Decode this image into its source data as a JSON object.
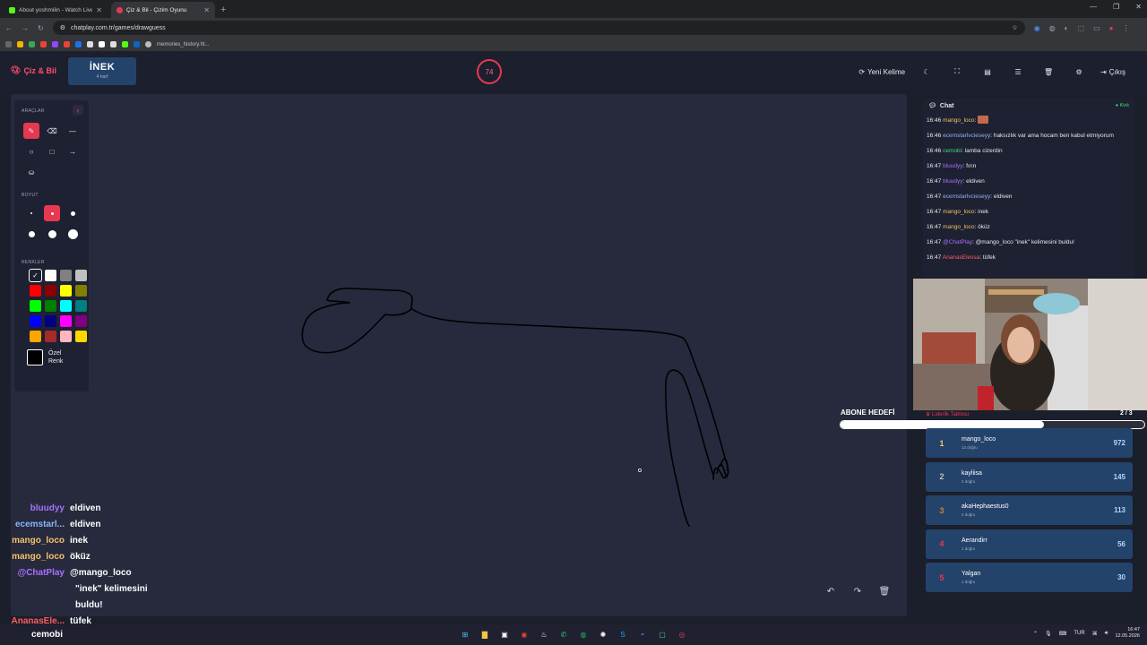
{
  "browser": {
    "tabs": [
      {
        "title": "About yoshmilin - Watch Live o...",
        "color": "#53fc18"
      },
      {
        "title": "Çiz & Bil - Çizim Oyunu",
        "color": "#e63950"
      }
    ],
    "url": "chatplay.com.tr/games/drawguess",
    "bookmark": "memories_history.ht..."
  },
  "header": {
    "logo": "Çiz & Bil",
    "word": "İNEK",
    "word_hint": "4 harf",
    "timer": "74",
    "new_word_label": "Yeni Kelime",
    "exit_label": "Çıkış"
  },
  "tools": {
    "section_tools": "ARAÇLAR",
    "section_size": "BOYUT",
    "section_colors": "RENKLER",
    "custom_color_label": "Özel Renk",
    "selected_tool": "brush",
    "colors": [
      "#000000",
      "#ffffff",
      "#808080",
      "#c0c0c0",
      "#ff0000",
      "#8b0000",
      "#ffff00",
      "#808000",
      "#00ff00",
      "#008000",
      "#00ffff",
      "#008080",
      "#0000ff",
      "#000080",
      "#ff00ff",
      "#800080",
      "#ffa500",
      "#a52a2a",
      "#ffb6c1",
      "#ffd700"
    ],
    "accent": "#e63950"
  },
  "overlay_chat": [
    {
      "user": "bluudyy",
      "msg": "eldiven",
      "color": "#a970ff"
    },
    {
      "user": "ecemstarl...",
      "msg": "eldiven",
      "color": "#8ab4f8"
    },
    {
      "user": "mango_loco",
      "msg": "inek",
      "color": "#f5c16c"
    },
    {
      "user": "mango_loco",
      "msg": "öküz",
      "color": "#f5c16c"
    },
    {
      "user": "@ChatPlay",
      "msg": "@mango_loco",
      "color": "#a970ff"
    }
  ],
  "overlay_wrap_1": "\"inek\" kelimesini",
  "overlay_wrap_2": "buldu!",
  "overlay_last": {
    "user": "AnanasEle...",
    "msg": "tüfek",
    "color": "#ff5c5c"
  },
  "chat": {
    "title": "Chat",
    "platform": "Kick",
    "messages": [
      {
        "time": "16:46",
        "user": "mango_loco",
        "msg": "",
        "color": "#f5c16c"
      },
      {
        "time": "16:46",
        "user": "ecemstarlvcieseyy",
        "msg": "haksızlık var ama hocam ben kabul etmiyorum",
        "color": "#8ab4f8"
      },
      {
        "time": "16:46",
        "user": "cemobi",
        "msg": "lamba cizerdin",
        "color": "#3ddc84"
      },
      {
        "time": "16:47",
        "user": "bluudyy",
        "msg": "fırın",
        "color": "#a970ff"
      },
      {
        "time": "16:47",
        "user": "bluudyy",
        "msg": "eldiven",
        "color": "#a970ff"
      },
      {
        "time": "16:47",
        "user": "ecemstarlvcieseyy",
        "msg": "eldiven",
        "color": "#8ab4f8"
      },
      {
        "time": "16:47",
        "user": "mango_loco",
        "msg": "inek",
        "color": "#f5c16c"
      },
      {
        "time": "16:47",
        "user": "mango_loco",
        "msg": "öküz",
        "color": "#f5c16c"
      },
      {
        "time": "16:47",
        "user": "@ChatPlay",
        "msg": "@mango_loco \"inek\" kelimesini buldu!",
        "color": "#a970ff"
      },
      {
        "time": "16:47",
        "user": "AnanasElessa",
        "msg": "tüfek",
        "color": "#ff5c5c"
      }
    ]
  },
  "goal": {
    "label": "ABONE HEDEFİ",
    "count": "2 / 3",
    "progress": 0.67
  },
  "leaderboard": {
    "title": "Liderlik Tablosu",
    "rows": [
      {
        "rank": "1",
        "name": "mango_loco",
        "sub": "13 doğru",
        "score": "972",
        "color": "#f5c16c"
      },
      {
        "rank": "2",
        "name": "kayliisa",
        "sub": "2 doğru",
        "score": "145",
        "color": "#c0c0c0"
      },
      {
        "rank": "3",
        "name": "akaHephaestus0",
        "sub": "2 doğru",
        "score": "113",
        "color": "#cd7f32"
      },
      {
        "rank": "4",
        "name": "Aerandirr",
        "sub": "1 doğru",
        "score": "56",
        "color": "#e63950"
      },
      {
        "rank": "5",
        "name": "Yalgan",
        "sub": "1 doğru",
        "score": "30",
        "color": "#e63950"
      }
    ]
  },
  "taskbar": {
    "user": "cemobi",
    "lang": "TUR",
    "time": "16:47",
    "date": "12.05.2026"
  }
}
